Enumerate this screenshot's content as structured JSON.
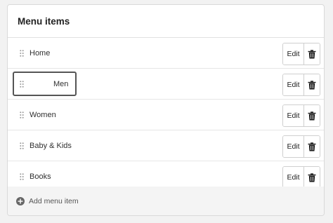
{
  "card": {
    "title": "Menu items"
  },
  "items": [
    {
      "label": "Home",
      "edit_label": "Edit"
    },
    {
      "label": "Men",
      "edit_label": "Edit"
    },
    {
      "label": "Women",
      "edit_label": "Edit"
    },
    {
      "label": "Baby & Kids",
      "edit_label": "Edit"
    },
    {
      "label": "Books",
      "edit_label": "Edit"
    }
  ],
  "footer": {
    "add_label": "Add menu item"
  },
  "icons": {
    "drag": "drag-handle-icon",
    "delete": "trash-icon",
    "add": "plus-circle-icon"
  }
}
